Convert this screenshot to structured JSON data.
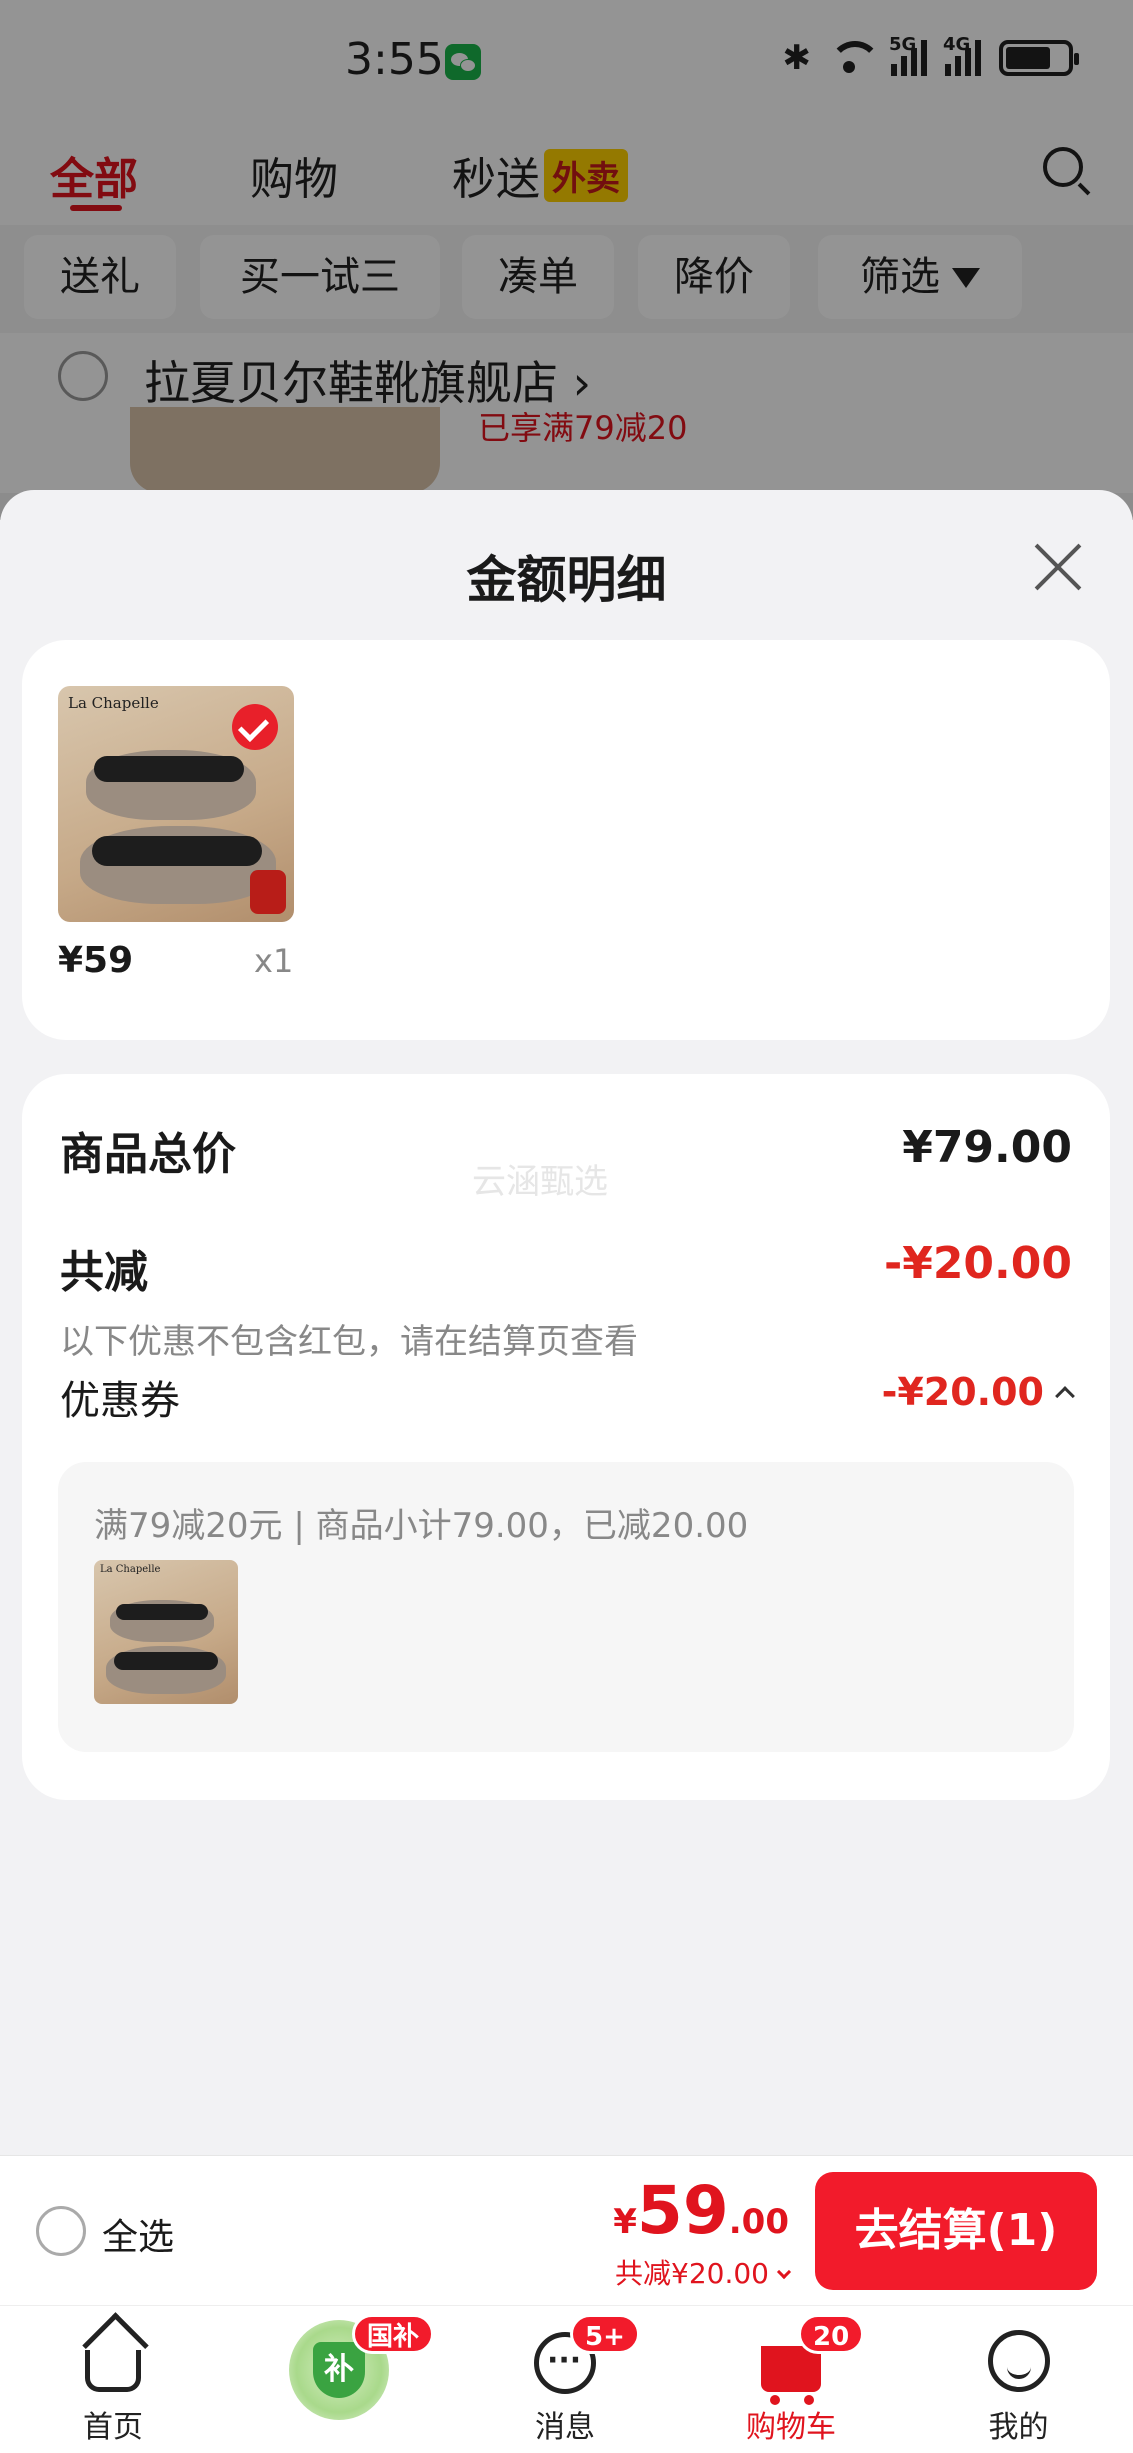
{
  "status_bar": {
    "time": "3:55",
    "sig1_label": "5G",
    "sig2_label": "4G"
  },
  "top_tabs": {
    "all": "全部",
    "shopping": "购物",
    "express": "秒送",
    "takeout_badge": "外卖"
  },
  "filters": [
    "送礼",
    "买一试三",
    "凑单",
    "降价",
    "筛选"
  ],
  "store": {
    "name": "拉夏贝尔鞋靴旗舰店",
    "promo": "已享满79减20"
  },
  "sheet": {
    "title": "金额明细",
    "item": {
      "brand": "La Chapelle",
      "price": "¥59",
      "qty": "x1"
    },
    "summary": {
      "total_label": "商品总价",
      "total_value": "¥79.00",
      "discount_label": "共减",
      "discount_value": "-¥20.00",
      "note": "以下优惠不包含红包，请在结算页查看",
      "coupon_label": "优惠券",
      "coupon_value": "-¥20.00",
      "coupon_detail": "满79减20元 | 商品小计79.00，已减20.00",
      "coupon_thumb_brand": "La Chapelle"
    },
    "watermark": "云涵甄选"
  },
  "checkout": {
    "select_all": "全选",
    "yen": "¥",
    "amount_main": "59",
    "amount_cents": ".00",
    "saving": "共减¥20.00",
    "button": "去结算(1)"
  },
  "bottom_nav": {
    "home": "首页",
    "guobu_badge": "国补",
    "messages": "消息",
    "messages_badge": "5+",
    "cart": "购物车",
    "cart_badge": "20",
    "me": "我的"
  },
  "colors": {
    "accent": "#e0141e",
    "button": "#f21b2b"
  }
}
